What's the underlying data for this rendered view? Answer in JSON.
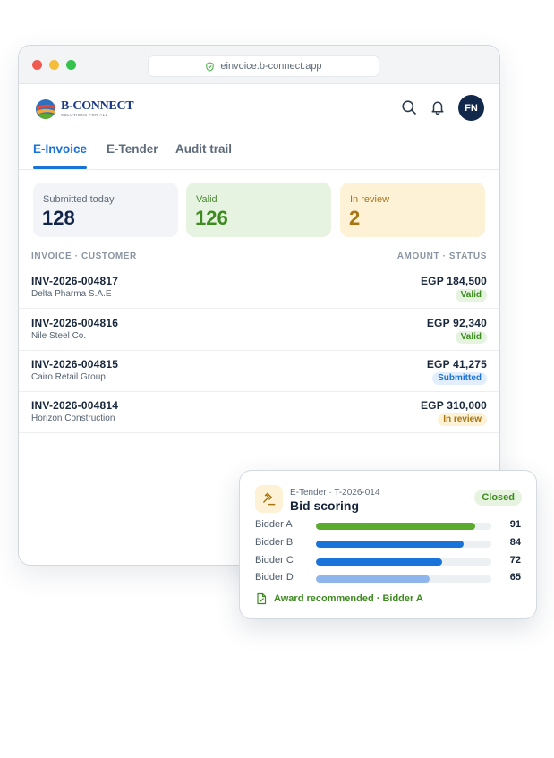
{
  "browser": {
    "url": "einvoice.b-connect.app"
  },
  "brand": {
    "name": "B-CONNECT",
    "tagline": "SOLUTIONS FOR ALL"
  },
  "header": {
    "avatar_initials": "FN"
  },
  "tabs": [
    {
      "label": "E-Invoice",
      "active": true
    },
    {
      "label": "E-Tender",
      "active": false
    },
    {
      "label": "Audit trail",
      "active": false
    }
  ],
  "stats": [
    {
      "label": "Submitted today",
      "value": "128"
    },
    {
      "label": "Valid",
      "value": "126"
    },
    {
      "label": "In review",
      "value": "2"
    }
  ],
  "list": {
    "col_left": "INVOICE · CUSTOMER",
    "col_right": "AMOUNT · STATUS",
    "rows": [
      {
        "invoice": "INV-2026-004817",
        "customer": "Delta Pharma S.A.E",
        "amount": "EGP 184,500",
        "status": "Valid"
      },
      {
        "invoice": "INV-2026-004816",
        "customer": "Nile Steel Co.",
        "amount": "EGP 92,340",
        "status": "Valid"
      },
      {
        "invoice": "INV-2026-004815",
        "customer": "Cairo Retail Group",
        "amount": "EGP 41,275",
        "status": "Submitted"
      },
      {
        "invoice": "INV-2026-004814",
        "customer": "Horizon Construction",
        "amount": "EGP 310,000",
        "status": "In review"
      }
    ]
  },
  "tender_card": {
    "subtitle": "E-Tender · T-2026-014",
    "title": "Bid scoring",
    "status": "Closed",
    "bidders": [
      {
        "name": "Bidder A",
        "score": "91",
        "level": 0.91,
        "color": "#5aab2e"
      },
      {
        "name": "Bidder B",
        "score": "84",
        "level": 0.84,
        "color": "#1a73d8"
      },
      {
        "name": "Bidder C",
        "score": "72",
        "level": 0.72,
        "color": "#1a73d8"
      },
      {
        "name": "Bidder D",
        "score": "65",
        "level": 0.65,
        "color": "#8fb6ec"
      }
    ],
    "award_text": "Award recommended · Bidder A"
  },
  "colors": {
    "accent": "#1a73d8",
    "valid": "#3d8a1f",
    "review": "#a87512",
    "navy": "#12294b"
  }
}
